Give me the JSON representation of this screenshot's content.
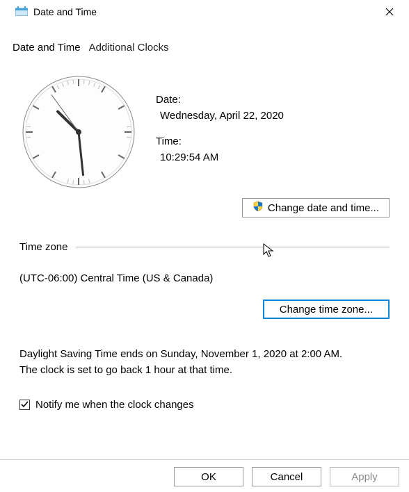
{
  "window": {
    "title": "Date and Time"
  },
  "tabs": [
    {
      "label": "Date and Time"
    },
    {
      "label": "Additional Clocks"
    }
  ],
  "date": {
    "label": "Date:",
    "value": "Wednesday, April 22, 2020"
  },
  "time": {
    "label": "Time:",
    "value": "10:29:54 AM"
  },
  "change_datetime_label": "Change date and time...",
  "timezone": {
    "heading": "Time zone",
    "value": "(UTC-06:00) Central Time (US & Canada)",
    "change_label": "Change time zone..."
  },
  "dst": {
    "line1": "Daylight Saving Time ends on Sunday, November 1, 2020 at 2:00 AM.",
    "line2": "The clock is set to go back 1 hour at that time."
  },
  "notify_checkbox": {
    "label": "Notify me when the clock changes",
    "checked": true
  },
  "buttons": {
    "ok": "OK",
    "cancel": "Cancel",
    "apply": "Apply"
  },
  "clock": {
    "hour": 10,
    "minute": 29,
    "second": 54
  }
}
